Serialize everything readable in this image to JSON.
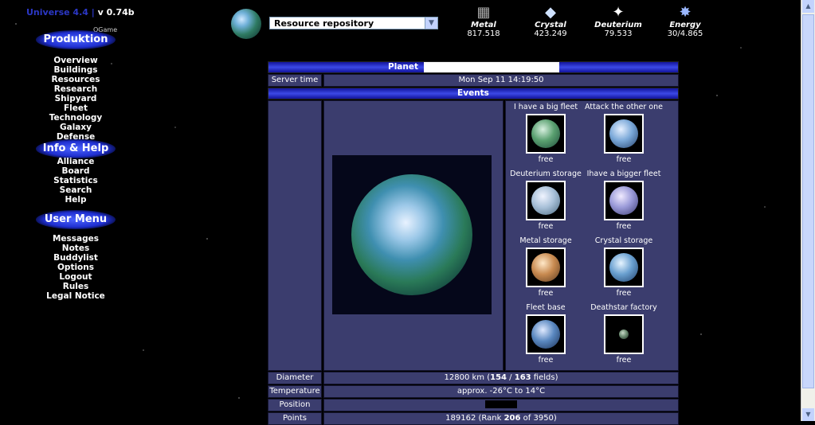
{
  "left_menu": {
    "universe_prefix": "Universe 4.4 |",
    "version": "v 0.74b",
    "ogame_label": "OGame",
    "produktion_title": "Produktion",
    "produktion_items": [
      "Overview",
      "Buildings",
      "Resources",
      "Research",
      "Shipyard",
      "Fleet",
      "Technology",
      "Galaxy",
      "Defense"
    ],
    "info_title": "Info & Help",
    "info_items": [
      "Alliance",
      "Board",
      "Statistics",
      "Search",
      "Help"
    ],
    "user_title": "User Menu",
    "user_items": [
      "Messages",
      "Notes",
      "Buddylist",
      "Options",
      "Logout",
      "Rules",
      "Legal Notice"
    ]
  },
  "top": {
    "planet_select_value": "Resource repository",
    "resources": [
      {
        "name": "Metal",
        "value": "817.518",
        "icon": "metal-icon"
      },
      {
        "name": "Crystal",
        "value": "423.249",
        "icon": "crystal-icon"
      },
      {
        "name": "Deuterium",
        "value": "79.533",
        "icon": "deuterium-icon"
      },
      {
        "name": "Energy",
        "value": "30/4.865",
        "icon": "energy-icon"
      }
    ]
  },
  "overview": {
    "planet_header": "Planet",
    "server_time_label": "Server time",
    "server_time_value": "Mon Sep 11 14:19:50",
    "events_header": "Events",
    "moons": [
      {
        "title": "I have a big fleet",
        "status": "free"
      },
      {
        "title": "Attack the other one",
        "status": "free"
      },
      {
        "title": "Deuterium storage",
        "status": "free"
      },
      {
        "title": "Ihave a bigger fleet",
        "status": "free"
      },
      {
        "title": "Metal storage",
        "status": "free"
      },
      {
        "title": "Crystal storage",
        "status": "free"
      },
      {
        "title": "Fleet base",
        "status": "free"
      },
      {
        "title": "Deathstar factory",
        "status": "free"
      }
    ],
    "diameter_label": "Diameter",
    "diameter_value": "12800 km (",
    "fields_used": "154",
    "fields_sep": " / ",
    "fields_total": "163",
    "fields_suffix": " fields)",
    "temperature_label": "Temperature",
    "temperature_value": "approx. -26°C to 14°C",
    "position_label": "Position",
    "points_label": "Points",
    "points_value": "189162 (Rank ",
    "rank": "206",
    "rank_suffix": " of 3950)"
  },
  "colors": {
    "menu_blue": "#1f2fd0",
    "panel": "#3b3d6e",
    "header_bar": "#3c49e6"
  }
}
